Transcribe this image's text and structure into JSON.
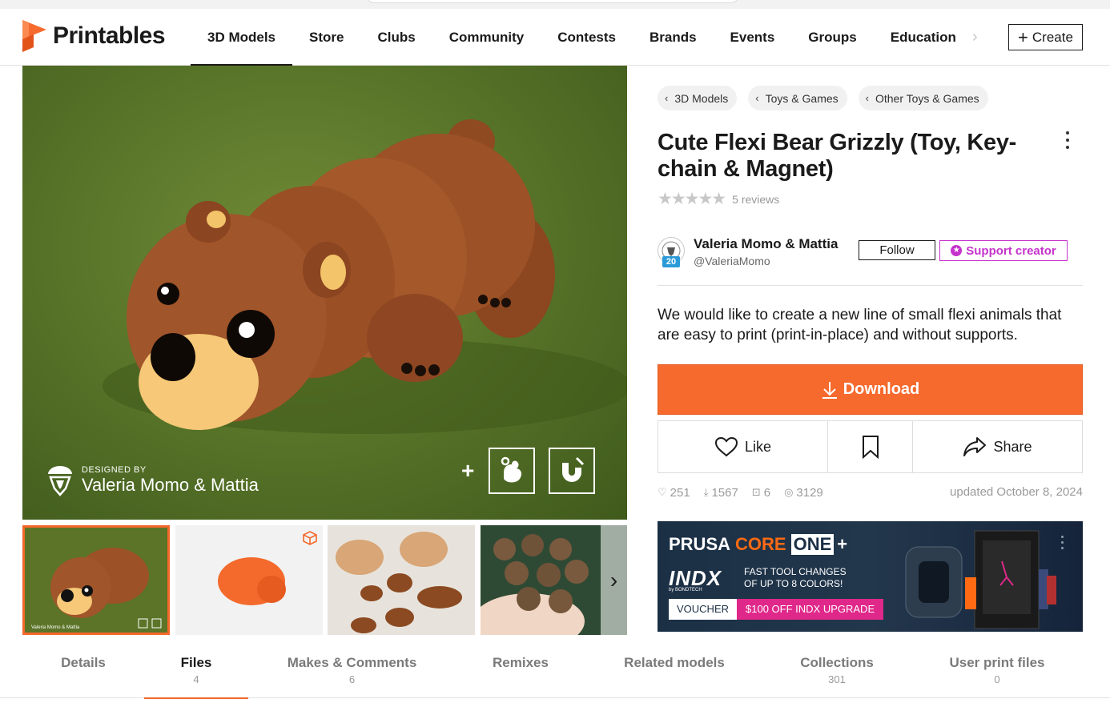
{
  "header": {
    "brand": "Printables",
    "nav": [
      "3D Models",
      "Store",
      "Clubs",
      "Community",
      "Contests",
      "Brands",
      "Events",
      "Groups",
      "Education"
    ],
    "create_label": "Create"
  },
  "hero": {
    "designed_by_label": "DESIGNED BY",
    "designer_name": "Valeria Momo & Mattia"
  },
  "breadcrumbs": [
    "3D Models",
    "Toys & Games",
    "Other Toys & Games"
  ],
  "model": {
    "title": "Cute Flexi Bear Grizzly (Toy, Key-chain & Magnet)",
    "stars": "★★★★★",
    "reviews": "5 reviews",
    "description": "We would like to create a new line of small flexi animals that are easy to print (print-in-place) and without supports."
  },
  "author": {
    "name": "Valeria Momo & Mattia",
    "handle": "@ValeriaMomo",
    "level": "20",
    "follow_label": "Follow",
    "support_label": "Support creator"
  },
  "actions": {
    "download_label": "Download",
    "like_label": "Like",
    "share_label": "Share"
  },
  "stats": {
    "likes": "251",
    "downloads": "1567",
    "makes": "6",
    "views": "3129",
    "updated": "updated October 8, 2024"
  },
  "ad": {
    "prusa": "PRUSA",
    "core": "CORE",
    "one": "ONE",
    "plus": "+",
    "indx": "INDX",
    "byline": "by BONDTECH",
    "fast1": "FAST TOOL CHANGES",
    "fast2": "OF UP TO 8 COLORS!",
    "voucher": "VOUCHER",
    "offer": "$100 OFF INDX UPGRADE"
  },
  "tabs": [
    {
      "label": "Details",
      "count": ""
    },
    {
      "label": "Files",
      "count": "4"
    },
    {
      "label": "Makes & Comments",
      "count": "6"
    },
    {
      "label": "Remixes",
      "count": ""
    },
    {
      "label": "Related models",
      "count": ""
    },
    {
      "label": "Collections",
      "count": "301"
    },
    {
      "label": "User print files",
      "count": "0"
    }
  ],
  "colors": {
    "accent": "#f66a2e",
    "support": "#c533cc",
    "level_badge": "#2a9ad8"
  }
}
